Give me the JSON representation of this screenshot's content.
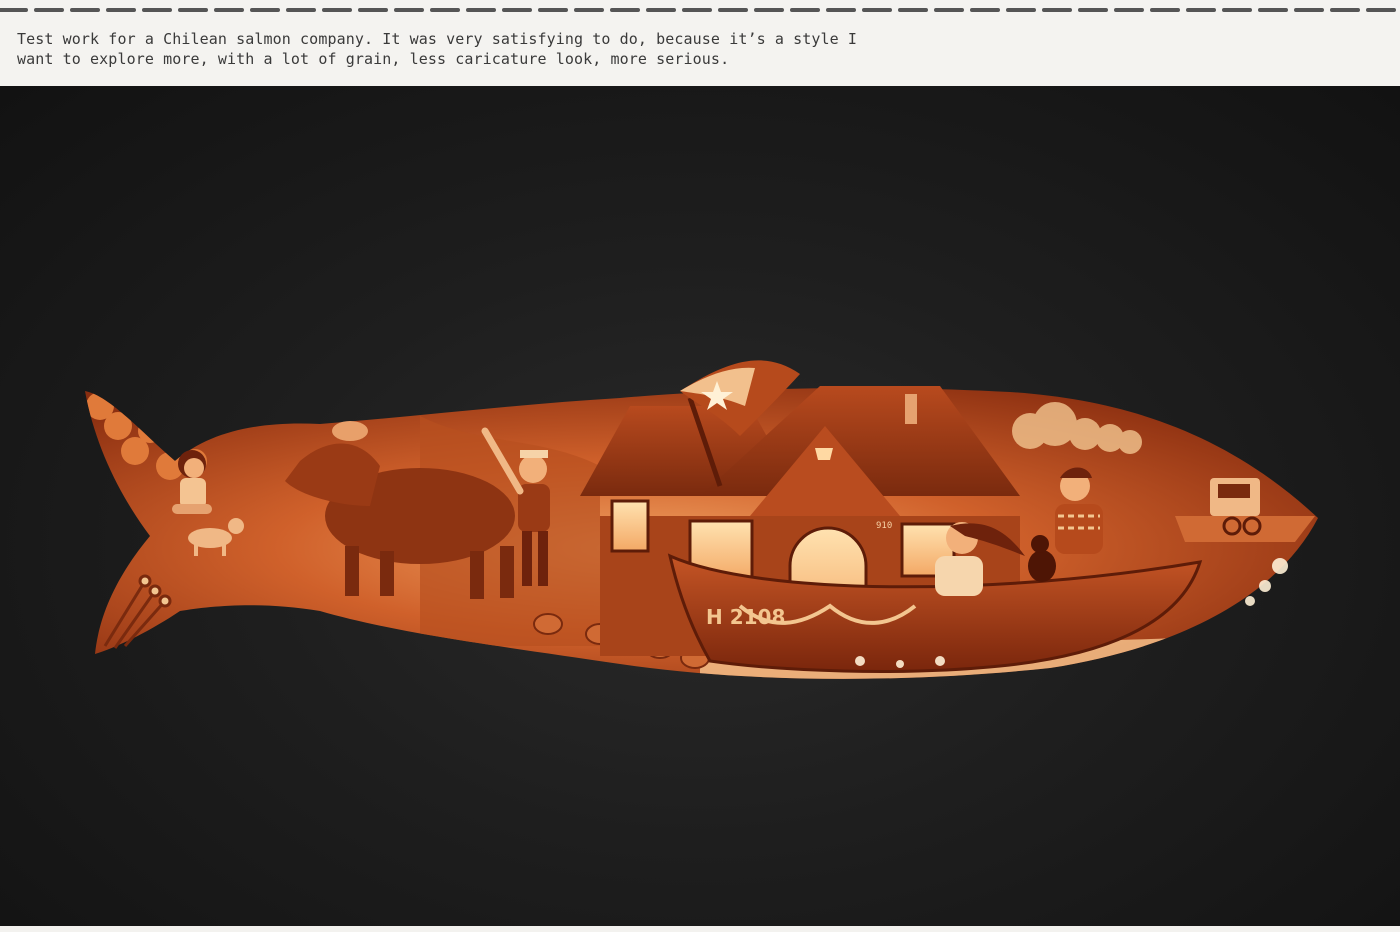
{
  "caption": {
    "line1": "Test work for a Chilean salmon company. It was very satisfying to do, because it’s a style I",
    "line2": "want to explore more, with a lot of grain, less caricature look, more serious."
  },
  "artwork": {
    "house_number": "910",
    "boat_registration": "H 2108"
  },
  "colors": {
    "background_dark": "#1c1c1c",
    "illustration_orange": "#d0612b",
    "illustration_dark": "#6e220c",
    "illustration_light": "#f7c48a",
    "header_bg": "#f4f3f0",
    "stitch": "#555555"
  },
  "icons": {
    "flag": "chilean-flag-icon",
    "star": "star-icon"
  }
}
